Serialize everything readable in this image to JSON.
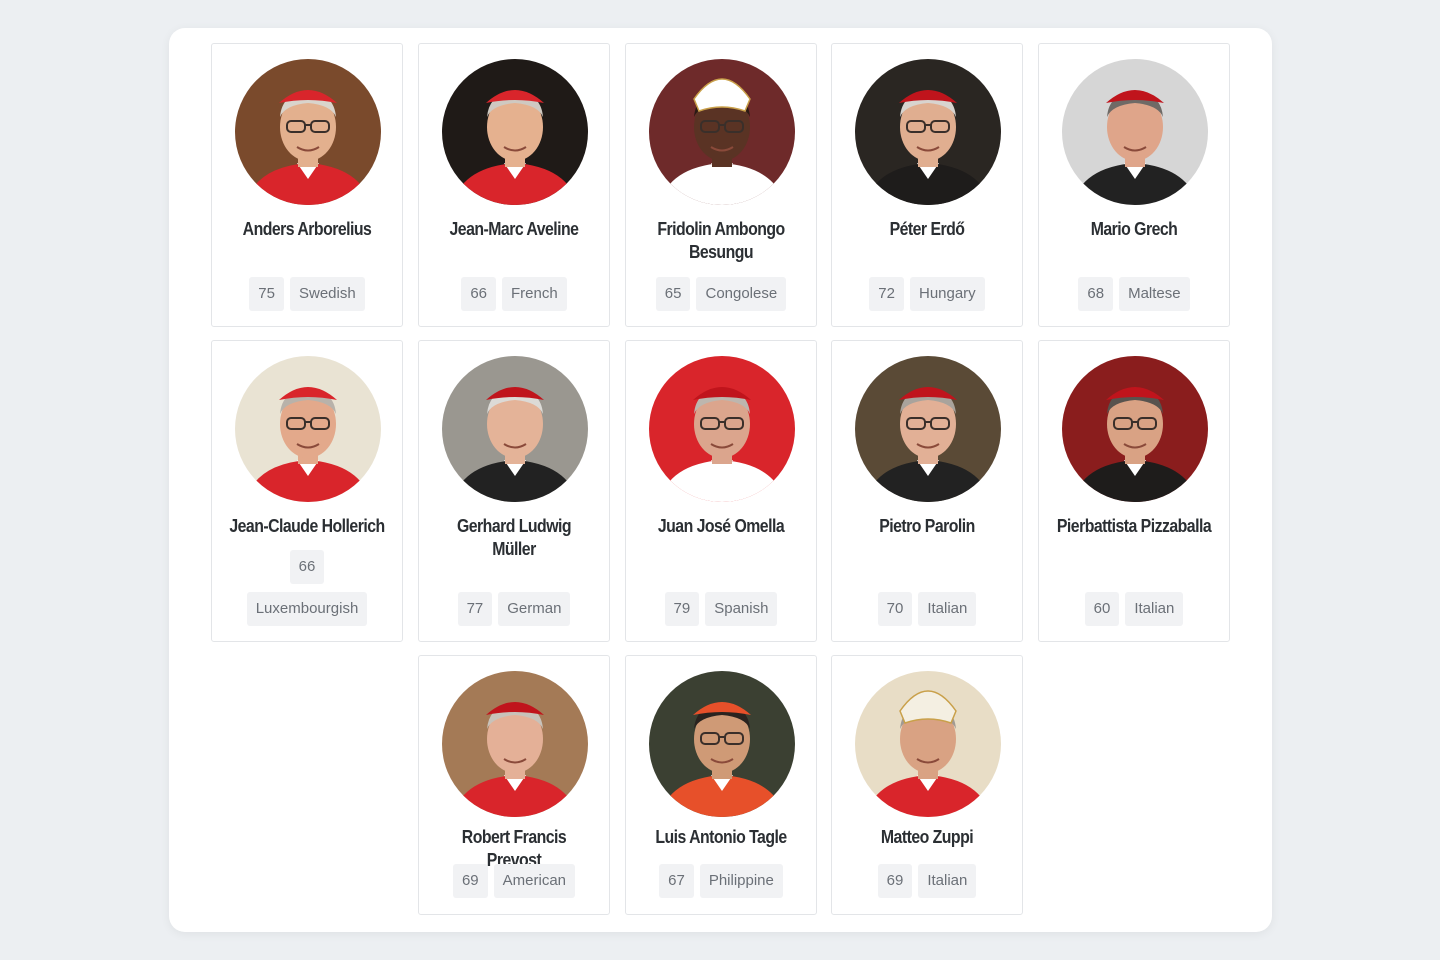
{
  "cardinals": [
    {
      "name": "Anders Arborelius",
      "age": "75",
      "nationality": "Swedish",
      "bg": "#7a4a2c",
      "skin": "#e3b08e",
      "hair": "#d9d4cc",
      "hat": "#d9252b",
      "robe": "#d9252b",
      "mitre": false,
      "glasses": true
    },
    {
      "name": "Jean-Marc Aveline",
      "age": "66",
      "nationality": "French",
      "bg": "#1f1a17",
      "skin": "#e5b18f",
      "hair": "#cfc9c1",
      "hat": "#d9252b",
      "robe": "#d9252b",
      "mitre": false,
      "glasses": false
    },
    {
      "name": "Fridolin Ambongo Besungu",
      "age": "65",
      "nationality": "Congolese",
      "bg": "#6e2a2a",
      "skin": "#5a3324",
      "hair": "#2a1a14",
      "hat": "#ffffff",
      "robe": "#ffffff",
      "mitre": true,
      "glasses": true
    },
    {
      "name": "Péter Erdő",
      "age": "72",
      "nationality": "Hungary",
      "bg": "#2a2622",
      "skin": "#e0ae90",
      "hair": "#d8d4cf",
      "hat": "#c0141c",
      "robe": "#1e1c1b",
      "mitre": false,
      "glasses": true
    },
    {
      "name": "Mario Grech",
      "age": "68",
      "nationality": "Maltese",
      "bg": "#d6d6d6",
      "skin": "#dfa58a",
      "hair": "#6f6a66",
      "hat": "#c0141c",
      "robe": "#222222",
      "mitre": false,
      "glasses": false
    },
    {
      "name": "Jean-Claude Hollerich",
      "age": "66",
      "nationality": "Luxembourgish",
      "bg": "#e9e3d3",
      "skin": "#e3a98b",
      "hair": "#b8b2aa",
      "hat": "#d9252b",
      "robe": "#d9252b",
      "mitre": false,
      "glasses": true
    },
    {
      "name": "Gerhard Ludwig Müller",
      "age": "77",
      "nationality": "German",
      "bg": "#9a9790",
      "skin": "#e4b398",
      "hair": "#dcdad6",
      "hat": "#c0141c",
      "robe": "#222222",
      "mitre": false,
      "glasses": false
    },
    {
      "name": "Juan José Omella",
      "age": "79",
      "nationality": "Spanish",
      "bg": "#d9252b",
      "skin": "#dba58d",
      "hair": "#bdb6ae",
      "hat": "#c0141c",
      "robe": "#ffffff",
      "mitre": false,
      "glasses": true
    },
    {
      "name": "Pietro Parolin",
      "age": "70",
      "nationality": "Italian",
      "bg": "#5a4a36",
      "skin": "#e2b096",
      "hair": "#a9a39c",
      "hat": "#c0141c",
      "robe": "#222222",
      "mitre": false,
      "glasses": true
    },
    {
      "name": "Pierbattista Pizzaballa",
      "age": "60",
      "nationality": "Italian",
      "bg": "#8a1d1d",
      "skin": "#d9a284",
      "hair": "#58534e",
      "hat": "#c0141c",
      "robe": "#1e1c1b",
      "mitre": false,
      "glasses": true
    },
    {
      "name": "Robert Francis Prevost",
      "age": "69",
      "nationality": "American",
      "bg": "#a47a56",
      "skin": "#e4b097",
      "hair": "#c8c2ba",
      "hat": "#c0141c",
      "robe": "#d9252b",
      "mitre": false,
      "glasses": false
    },
    {
      "name": "Luis Antonio Tagle",
      "age": "67",
      "nationality": "Philippine",
      "bg": "#3b4032",
      "skin": "#cf9a76",
      "hair": "#2a231f",
      "hat": "#e7502a",
      "robe": "#e7502a",
      "mitre": false,
      "glasses": true
    },
    {
      "name": "Matteo Zuppi",
      "age": "69",
      "nationality": "Italian",
      "bg": "#e8ddc6",
      "skin": "#d9a283",
      "hair": "#a19a92",
      "hat": "#f4efe2",
      "robe": "#d9252b",
      "mitre": true,
      "glasses": false
    }
  ]
}
